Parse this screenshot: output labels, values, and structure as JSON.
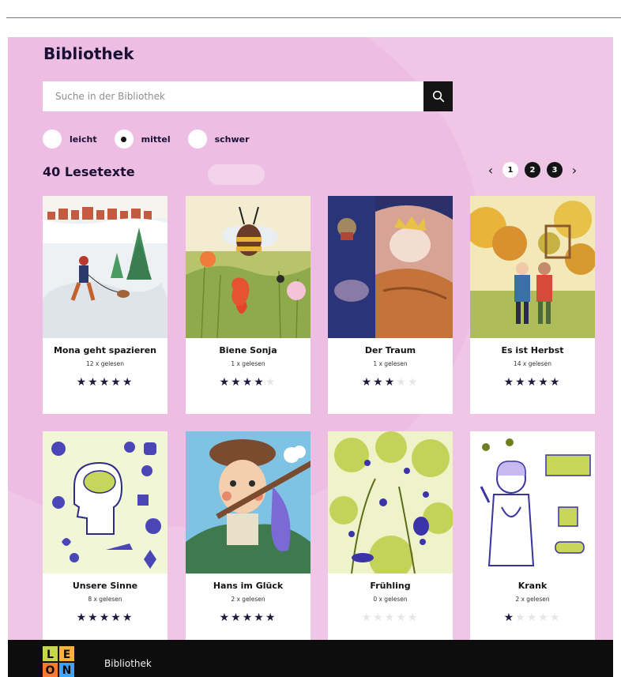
{
  "header": {
    "title": "Bibliothek"
  },
  "search": {
    "placeholder": "Suche in der Bibliothek",
    "button_icon": "search-icon"
  },
  "levels": [
    {
      "label": "leicht",
      "selected": false
    },
    {
      "label": "mittel",
      "selected": true
    },
    {
      "label": "schwer",
      "selected": false
    }
  ],
  "library": {
    "count_label": "40 Lesetexte"
  },
  "pagination": {
    "prev_icon": "chevron-left-icon",
    "next_icon": "chevron-right-icon",
    "pages": [
      "1",
      "2",
      "3"
    ],
    "current": "1"
  },
  "texts": [
    {
      "title": "Mona geht spazieren",
      "reads": "12 x gelesen",
      "rating": 5
    },
    {
      "title": "Biene Sonja",
      "reads": "1 x gelesen",
      "rating": 4
    },
    {
      "title": "Der Traum",
      "reads": "1 x gelesen",
      "rating": 3
    },
    {
      "title": "Es ist Herbst",
      "reads": "14 x gelesen",
      "rating": 5
    },
    {
      "title": "Unsere Sinne",
      "reads": "8 x gelesen",
      "rating": 5
    },
    {
      "title": "Hans im Glück",
      "reads": "2 x gelesen",
      "rating": 5
    },
    {
      "title": "Frühling",
      "reads": "0 x gelesen",
      "rating": 0
    },
    {
      "title": "Krank",
      "reads": "2 x gelesen",
      "rating": 1
    }
  ],
  "footer": {
    "logo_letters": [
      "L",
      "E",
      "O",
      "N"
    ],
    "nav_label": "Bibliothek"
  },
  "colors": {
    "background": "#f0c6e6",
    "footer": "#0d0d0d",
    "star": "#1e1b3f"
  }
}
